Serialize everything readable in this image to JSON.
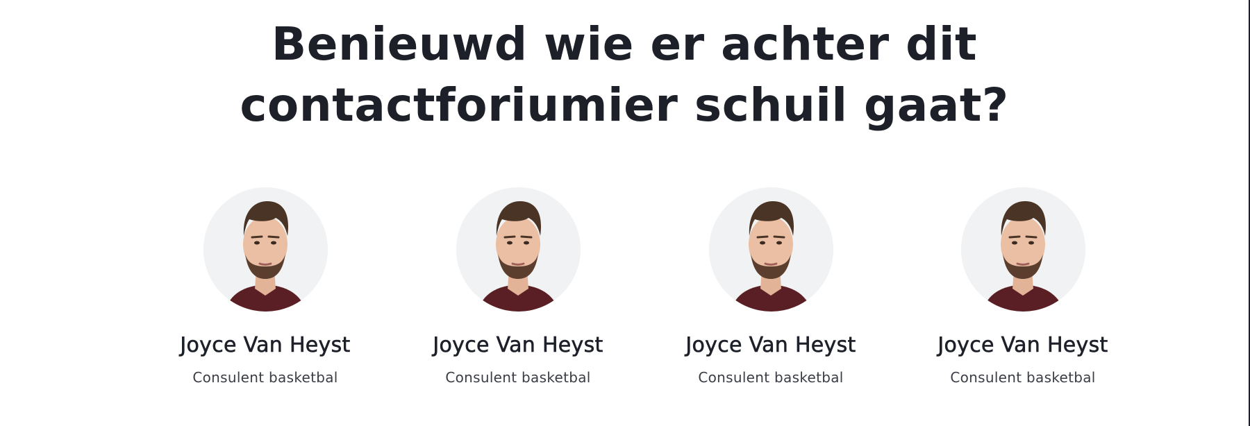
{
  "heading": {
    "line1": "Benieuwd wie er achter dit",
    "line2": "contactforiumier schuil gaat?"
  },
  "team": [
    {
      "name": "Joyce Van Heyst",
      "role": "Consulent basketbal"
    },
    {
      "name": "Joyce Van Heyst",
      "role": "Consulent basketbal"
    },
    {
      "name": "Joyce Van Heyst",
      "role": "Consulent basketbal"
    },
    {
      "name": "Joyce Van Heyst",
      "role": "Consulent basketbal"
    }
  ],
  "colors": {
    "text": "#1d2029",
    "subtext": "#3a3d45",
    "avatar_bg": "#f1f2f3",
    "shirt": "#5a1f24"
  }
}
